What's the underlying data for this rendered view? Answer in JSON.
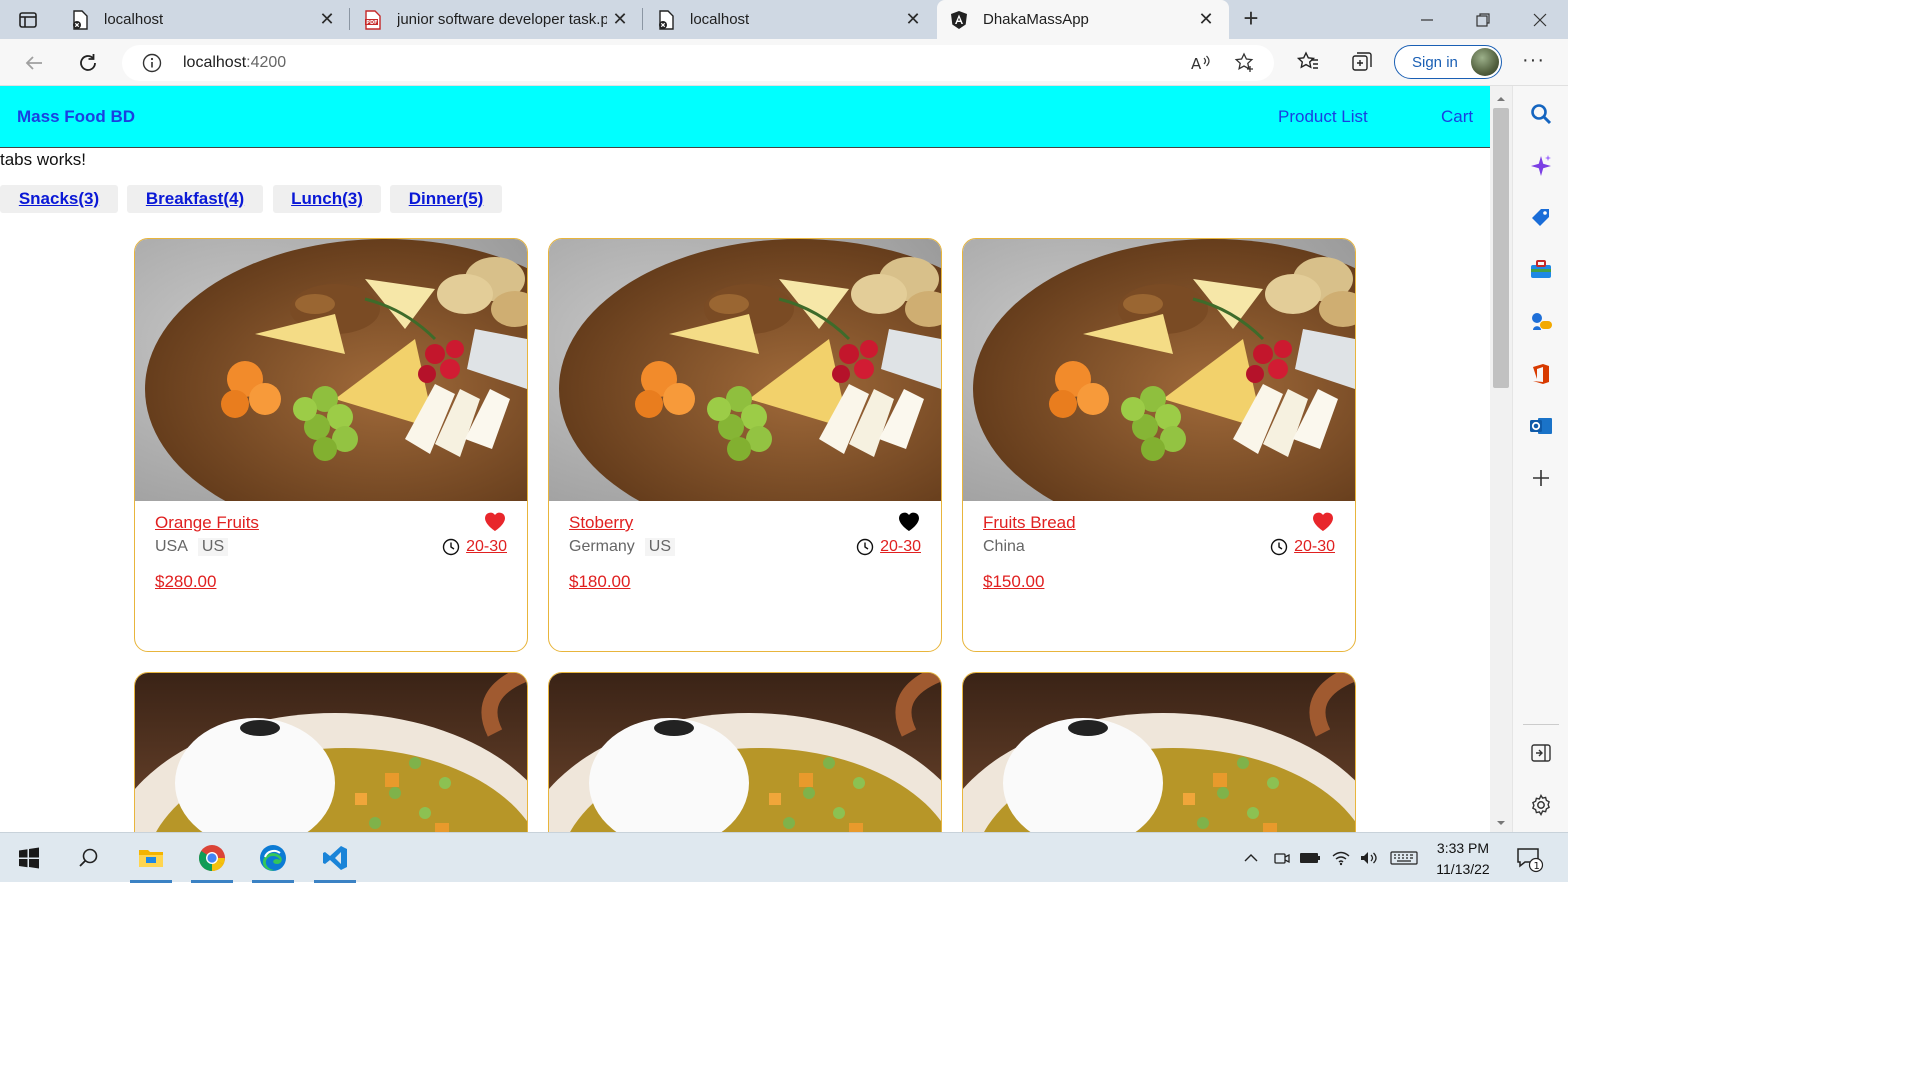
{
  "browser": {
    "tabs": [
      {
        "title": "localhost"
      },
      {
        "title": "junior software developer task.pdf"
      },
      {
        "title": "localhost"
      },
      {
        "title": "DhakaMassApp"
      }
    ],
    "url": "localhost",
    "url_port": ":4200",
    "sign_in_label": "Sign in",
    "more_label": "···"
  },
  "app": {
    "brand": "Mass Food BD",
    "nav": [
      {
        "label": "Product List"
      },
      {
        "label": "Cart"
      }
    ],
    "tabs_works": "tabs works!",
    "categories": [
      {
        "label": "Snacks(3)"
      },
      {
        "label": "Breakfast(4)"
      },
      {
        "label": "Lunch(3)"
      },
      {
        "label": "Dinner(5)"
      }
    ],
    "foods": [
      {
        "name": "Orange Fruits",
        "tags": [
          "USA",
          "US"
        ],
        "time": "20-30",
        "price": "$280.00",
        "favorite": true,
        "heart_color": "#e8262b",
        "image": "cheese-board"
      },
      {
        "name": "Stoberry",
        "tags": [
          "Germany",
          "US"
        ],
        "time": "20-30",
        "price": "$180.00",
        "favorite": false,
        "heart_color": "#000000",
        "image": "cheese-board"
      },
      {
        "name": "Fruits Bread",
        "tags": [
          "China"
        ],
        "time": "20-30",
        "price": "$150.00",
        "favorite": true,
        "heart_color": "#e8262b",
        "image": "cheese-board"
      },
      {
        "image": "curry-rice"
      },
      {
        "image": "curry-rice"
      },
      {
        "image": "curry-rice"
      }
    ],
    "colors": {
      "header_bg": "#00ffff",
      "link": "#1a40e0",
      "accent": "#e02020",
      "card_border": "#e8b53c"
    }
  },
  "taskbar": {
    "time": "3:33 PM",
    "date": "11/13/22",
    "notification_count": "1"
  }
}
